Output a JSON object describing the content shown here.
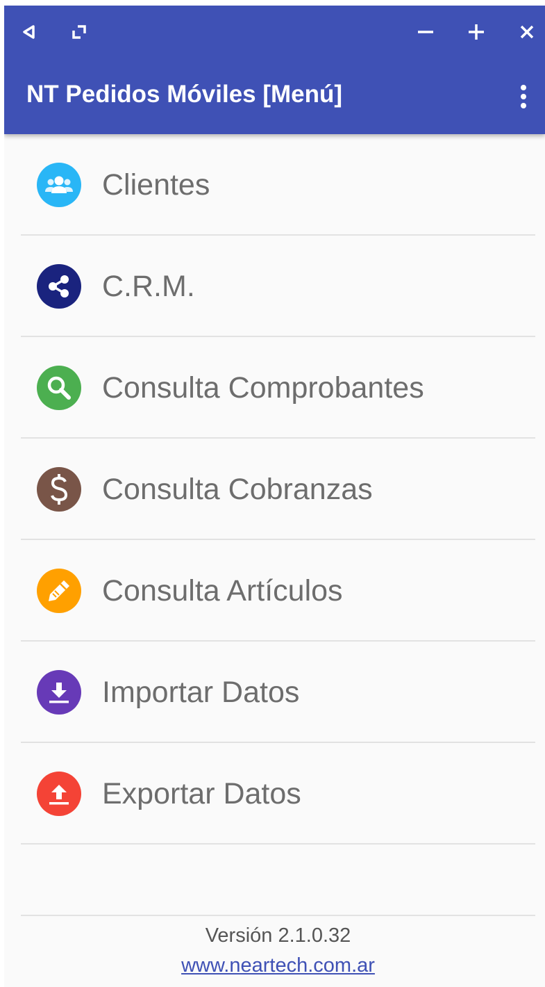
{
  "app": {
    "title": "NT Pedidos Móviles [Menú]"
  },
  "colors": {
    "appbar": "#3f51b5",
    "background": "#fafafa",
    "label": "#6d6d6d",
    "divider": "#e2e2e2",
    "link": "#3f51b5"
  },
  "window_controls": [
    {
      "name": "back",
      "icon": "triangle-left-icon"
    },
    {
      "name": "resize",
      "icon": "resize-icon"
    },
    {
      "name": "minimize",
      "icon": "minus-icon"
    },
    {
      "name": "zoom-in",
      "icon": "plus-icon"
    },
    {
      "name": "close",
      "icon": "close-icon"
    }
  ],
  "menu": {
    "items": [
      {
        "label": "Clientes",
        "icon": "users-icon",
        "color": "#29b6f6"
      },
      {
        "label": "C.R.M.",
        "icon": "share-icon",
        "color": "#1a237e"
      },
      {
        "label": "Consulta Comprobantes",
        "icon": "search-icon",
        "color": "#4caf50"
      },
      {
        "label": "Consulta Cobranzas",
        "icon": "dollar-icon",
        "color": "#795548"
      },
      {
        "label": "Consulta Artículos",
        "icon": "pencil-icon",
        "color": "#ffa000"
      },
      {
        "label": "Importar Datos",
        "icon": "download-icon",
        "color": "#673ab7"
      },
      {
        "label": "Exportar Datos",
        "icon": "upload-icon",
        "color": "#f44336"
      }
    ]
  },
  "footer": {
    "version": "Versión 2.1.0.32",
    "website": "www.neartech.com.ar"
  }
}
